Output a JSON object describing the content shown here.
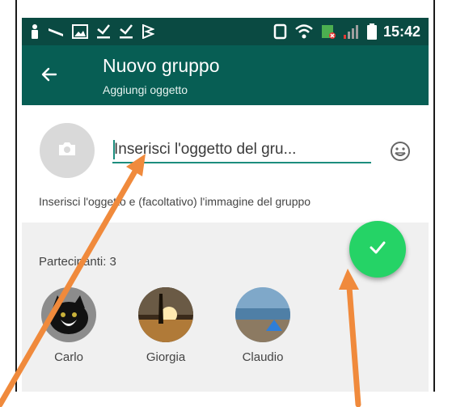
{
  "status_bar": {
    "time": "15:42",
    "notification_icons": [
      "person-icon",
      "signal-wave-icon",
      "image-icon",
      "download-check-icon",
      "download-check-icon",
      "flag-icon"
    ],
    "system_icons": [
      "vibrate-icon",
      "wifi-icon",
      "battery-saver-icon",
      "signal-bars-icon",
      "battery-icon"
    ]
  },
  "app_bar": {
    "title": "Nuovo gruppo",
    "subtitle": "Aggiungi oggetto",
    "color": "#075e54"
  },
  "subject": {
    "placeholder": "Inserisci l'oggetto del gru...",
    "value": "",
    "hint": "Inserisci l'oggetto e (facoltativo) l'immagine del gruppo"
  },
  "participants": {
    "title": "Partecipanti: 3",
    "list": [
      {
        "name": "Carlo",
        "photo": "black-white-cat-photo"
      },
      {
        "name": "Giorgia",
        "photo": "sunset-photo"
      },
      {
        "name": "Claudio",
        "photo": "beach-tent-photo"
      }
    ]
  },
  "confirm_button": {
    "icon": "checkmark-icon",
    "color": "#25d366"
  },
  "annotations": {
    "arrow_color": "#f08a3c"
  }
}
